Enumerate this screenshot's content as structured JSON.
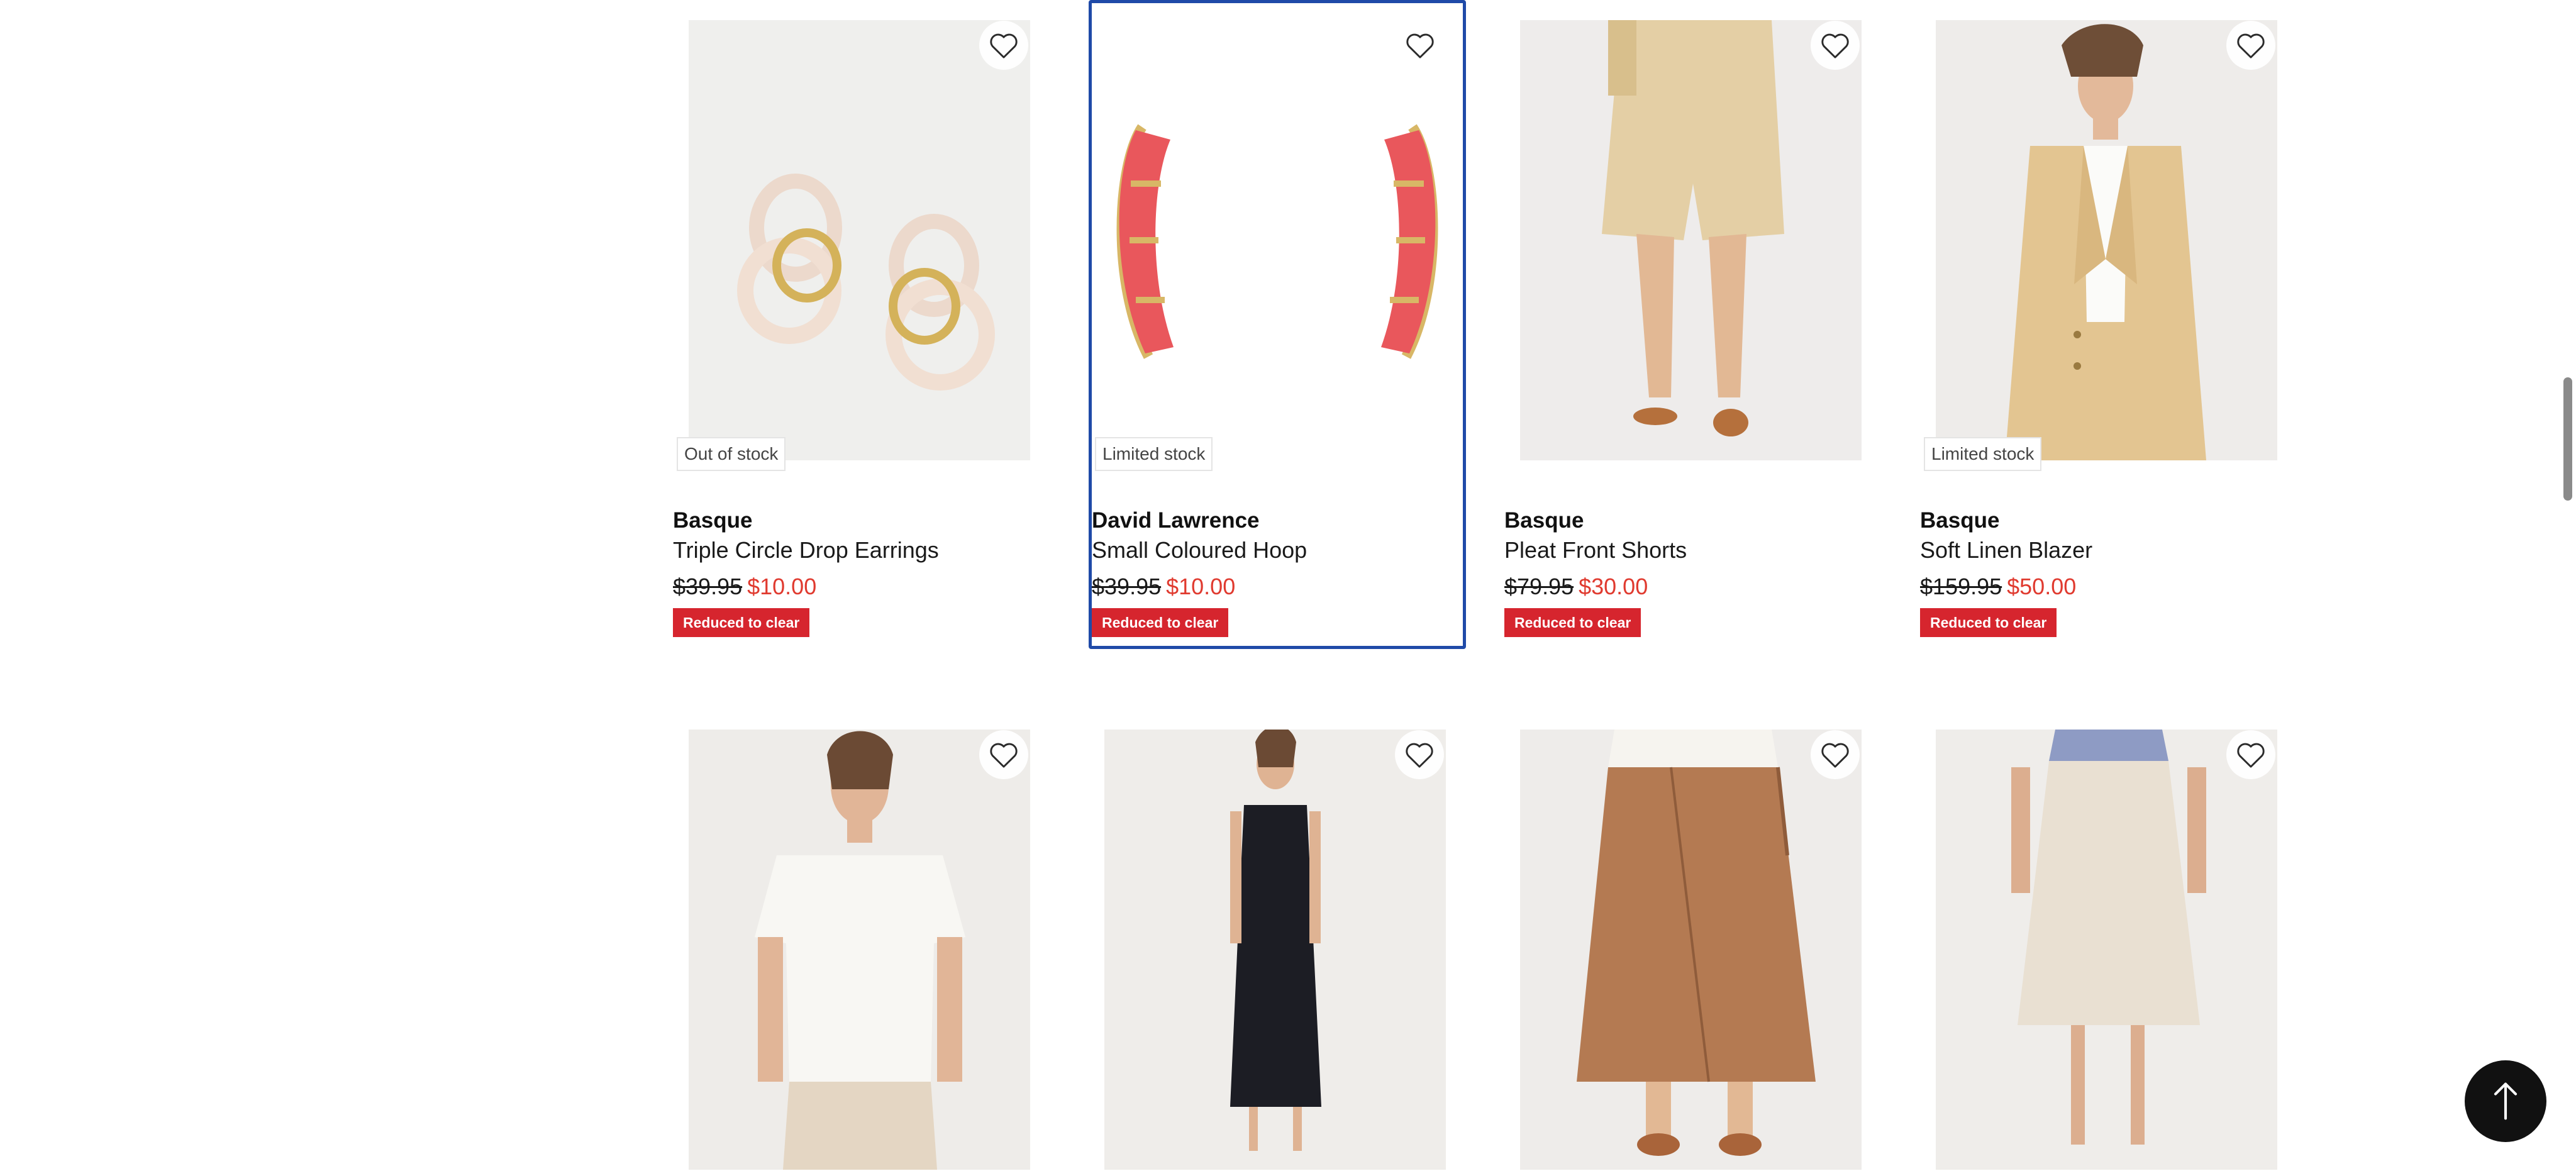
{
  "products_row1": [
    {
      "brand": "Basque",
      "name": "Triple Circle Drop Earrings",
      "was_price": "$39.95",
      "now_price": "$10.00",
      "badge": "Reduced to clear",
      "stock": "Out of stock"
    },
    {
      "brand": "David Lawrence",
      "name": "Small Coloured Hoop",
      "was_price": "$39.95",
      "now_price": "$10.00",
      "badge": "Reduced to clear",
      "stock": "Limited stock"
    },
    {
      "brand": "Basque",
      "name": "Pleat Front Shorts",
      "was_price": "$79.95",
      "now_price": "$30.00",
      "badge": "Reduced to clear",
      "stock": ""
    },
    {
      "brand": "Basque",
      "name": "Soft Linen Blazer",
      "was_price": "$159.95",
      "now_price": "$50.00",
      "badge": "Reduced to clear",
      "stock": "Limited stock"
    }
  ],
  "icons": {
    "wishlist": "heart-outline-icon",
    "back_to_top": "arrow-up-icon"
  },
  "colors": {
    "sale_price": "#e03a2f",
    "badge_bg": "#d6252e",
    "focus_outline": "#1f4aa8",
    "back_to_top_bg": "#111111"
  }
}
